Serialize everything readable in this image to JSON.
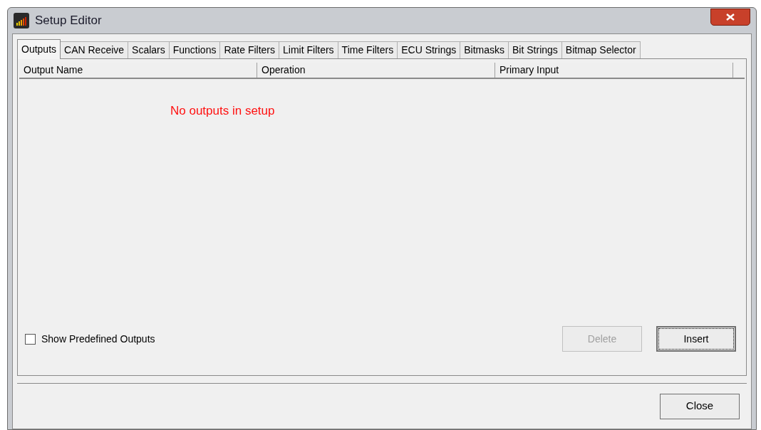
{
  "window": {
    "title": "Setup Editor"
  },
  "tabs": [
    {
      "label": "Outputs",
      "selected": true
    },
    {
      "label": "CAN Receive",
      "selected": false
    },
    {
      "label": "Scalars",
      "selected": false
    },
    {
      "label": "Functions",
      "selected": false
    },
    {
      "label": "Rate Filters",
      "selected": false
    },
    {
      "label": "Limit Filters",
      "selected": false
    },
    {
      "label": "Time Filters",
      "selected": false
    },
    {
      "label": "ECU Strings",
      "selected": false
    },
    {
      "label": "Bitmasks",
      "selected": false
    },
    {
      "label": "Bit Strings",
      "selected": false
    },
    {
      "label": "Bitmap Selector",
      "selected": false
    }
  ],
  "table": {
    "columns": [
      "Output Name",
      "Operation",
      "Primary Input"
    ],
    "empty_message": "No outputs in setup"
  },
  "show_predefined": {
    "label": "Show Predefined Outputs",
    "checked": false
  },
  "buttons": [
    {
      "label": "Delete",
      "disabled": true,
      "focused": false
    },
    {
      "label": "Insert",
      "disabled": false,
      "focused": true
    }
  ],
  "close_button": {
    "label": "Close"
  }
}
